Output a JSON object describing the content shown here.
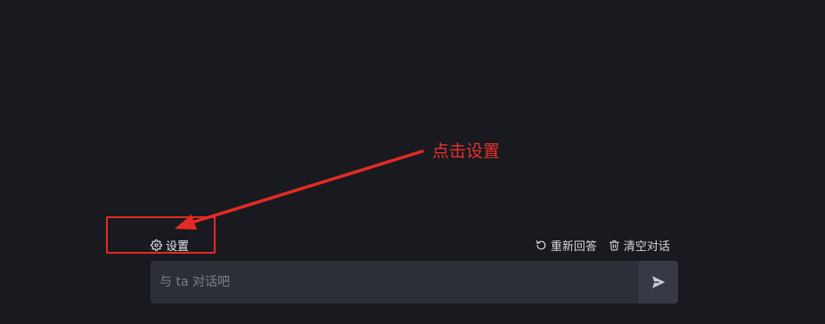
{
  "annotation": {
    "label": "点击设置",
    "color": "#e52a24"
  },
  "toolbar": {
    "settings_icon": "gear-icon",
    "settings_label": "设置",
    "regenerate_icon": "refresh-icon",
    "regenerate_label": "重新回答",
    "clear_icon": "trash-icon",
    "clear_label": "清空对话"
  },
  "chat": {
    "input_placeholder": "与 ta 对话吧",
    "input_value": "",
    "send_icon": "send-icon"
  },
  "colors": {
    "background": "#181a20",
    "input_background": "#2c2f38",
    "send_button_background": "#373a45",
    "text": "#e6e7ea",
    "placeholder": "#7b7f89"
  }
}
